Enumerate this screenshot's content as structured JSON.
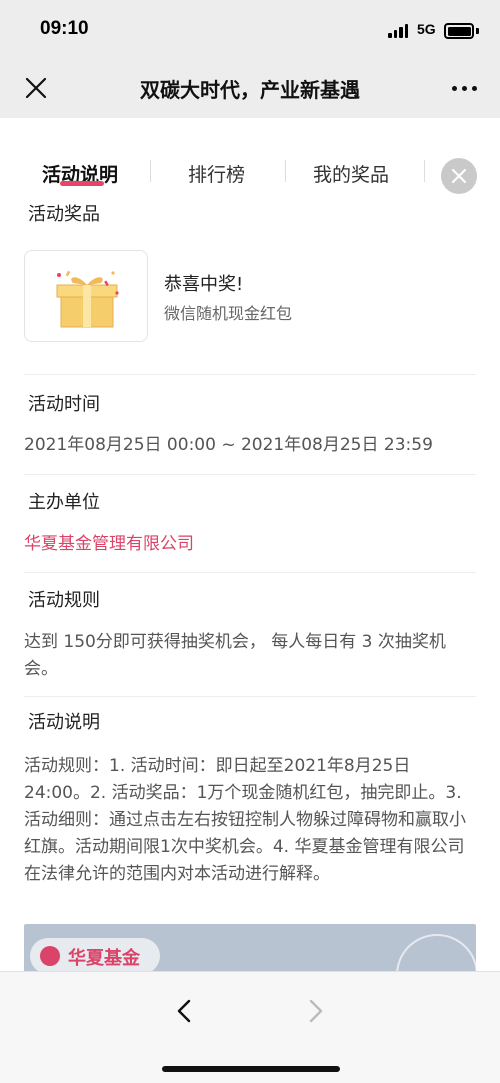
{
  "status_bar": {
    "time": "09:10",
    "network": "5G",
    "icons": [
      "signal-icon",
      "battery-icon"
    ]
  },
  "nav": {
    "title": "双碳大时代，产业新基遇",
    "icons": [
      "close-icon",
      "more-icon"
    ]
  },
  "tabs": [
    {
      "label": "活动说明",
      "active": true
    },
    {
      "label": "排行榜",
      "active": false
    },
    {
      "label": "我的奖品",
      "active": false
    }
  ],
  "sections": {
    "prize": {
      "title": "活动奖品",
      "prize_title": "恭喜中奖!",
      "prize_desc": "微信随机现金红包",
      "icon": "gift-icon"
    },
    "time": {
      "title": "活动时间",
      "value": "2021年08月25日 00:00 ~ 2021年08月25日 23:59"
    },
    "organizer": {
      "title": "主办单位",
      "value": "华夏基金管理有限公司"
    },
    "rules": {
      "title": "活动规则",
      "value": "达到 150分即可获得抽奖机会， 每人每日有 3 次抽奖机会。"
    },
    "description": {
      "title": "活动说明",
      "value": "活动规则：1. 活动时间：即日起至2021年8月25日24:00。2. 活动奖品：1万个现金随机红包，抽完即止。3. 活动细则：通过点击左右按钮控制人物躲过障碍物和赢取小红旗。活动期间限1次中奖机会。4. 华夏基金管理有限公司在法律允许的范围内对本活动进行解释。"
    }
  },
  "banner": {
    "logo_text": "华夏基金"
  },
  "bottom_bar": {
    "icons": [
      "back-arrow-icon",
      "forward-arrow-icon"
    ]
  },
  "colors": {
    "accent": "#e64567",
    "organizer": "#d94468",
    "background": "#ededed"
  }
}
